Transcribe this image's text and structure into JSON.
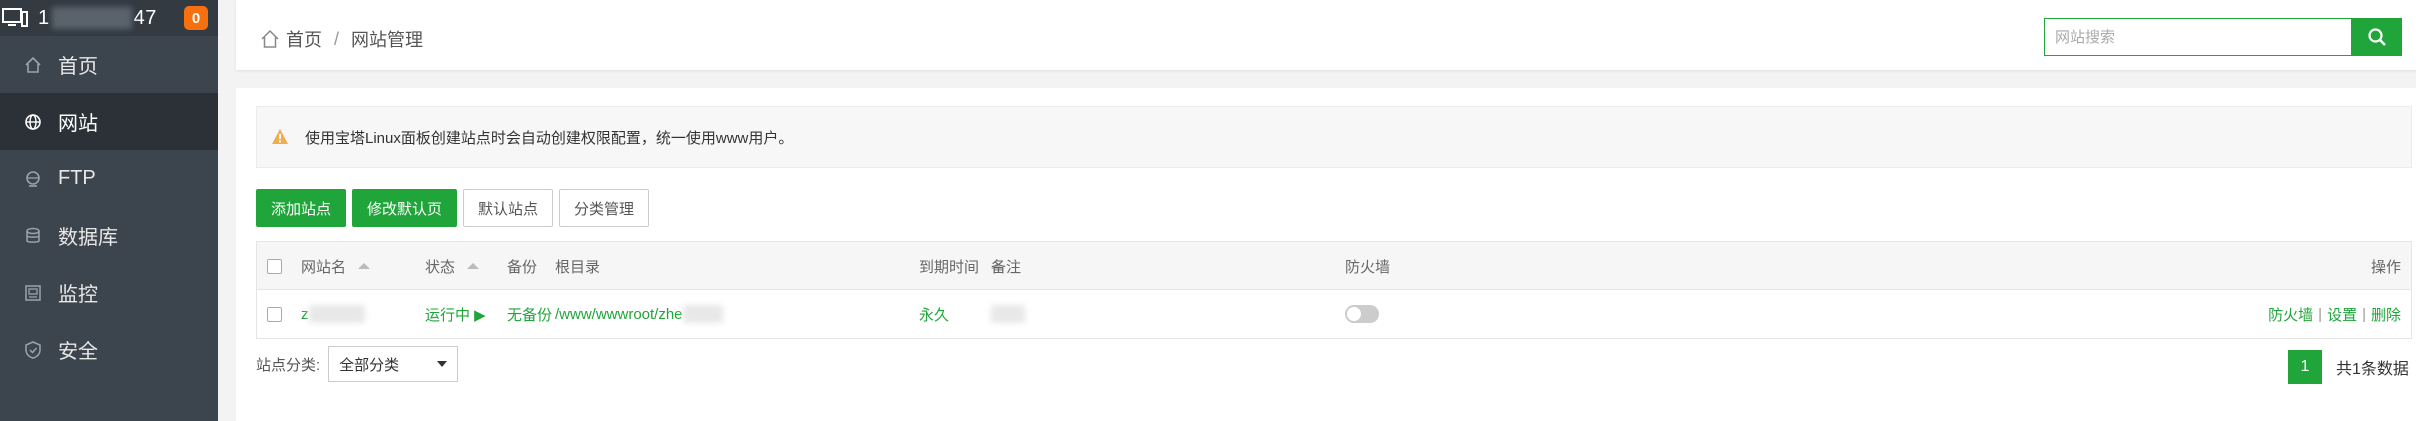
{
  "sidebar": {
    "server_ip_prefix": "1",
    "server_ip_suffix": "47",
    "notification_count": "0",
    "items": [
      {
        "label": "首页",
        "icon": "home-icon"
      },
      {
        "label": "网站",
        "icon": "globe-icon"
      },
      {
        "label": "FTP",
        "icon": "ftp-icon"
      },
      {
        "label": "数据库",
        "icon": "database-icon"
      },
      {
        "label": "监控",
        "icon": "monitor-icon"
      },
      {
        "label": "安全",
        "icon": "shield-icon"
      }
    ]
  },
  "header": {
    "breadcrumb_home": "首页",
    "breadcrumb_sep": "/",
    "breadcrumb_current": "网站管理",
    "search_placeholder": "网站搜索"
  },
  "notice": {
    "text": "使用宝塔Linux面板创建站点时会自动创建权限配置，统一使用www用户。"
  },
  "toolbar": {
    "add_site": "添加站点",
    "modify_default_page": "修改默认页",
    "default_site": "默认站点",
    "category_manage": "分类管理"
  },
  "table": {
    "columns": {
      "name": "网站名",
      "status": "状态",
      "backup": "备份",
      "root": "根目录",
      "expire": "到期时间",
      "remark": "备注",
      "firewall": "防火墙",
      "ops": "操作"
    },
    "rows": [
      {
        "name": "z",
        "status": "运行中 ▶",
        "backup": "无备份",
        "root": "/www/wwwroot/zhe",
        "expire": "永久",
        "firewall_on": false,
        "op_firewall": "防火墙",
        "op_settings": "设置",
        "op_delete": "删除",
        "op_sep": "|"
      }
    ]
  },
  "footer": {
    "category_label": "站点分类:",
    "category_selected": "全部分类",
    "current_page": "1",
    "total_text": "共1条数据"
  },
  "colors": {
    "accent": "#20a53a",
    "sidebar_bg": "#3c444d",
    "badge": "#f7700f"
  }
}
